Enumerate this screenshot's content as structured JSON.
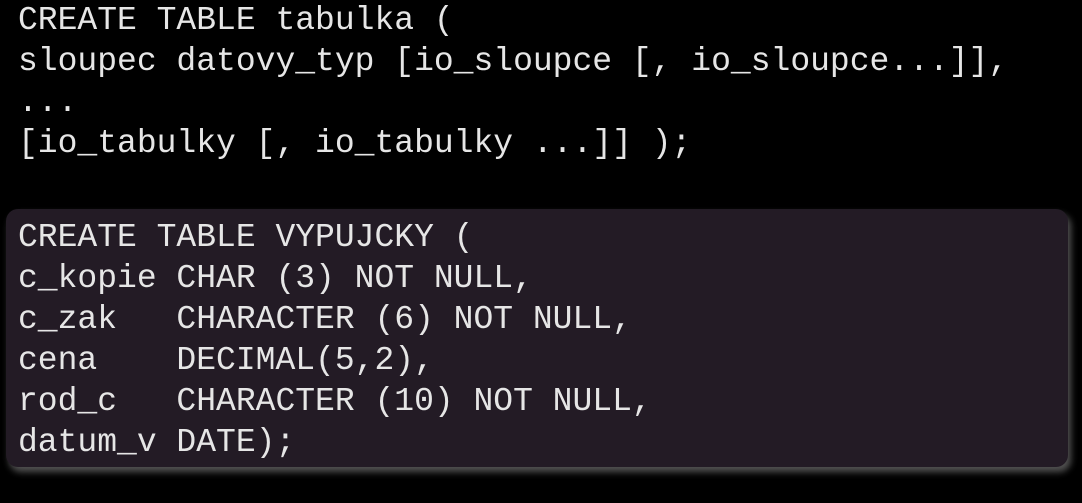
{
  "syntax": {
    "lines": [
      "CREATE TABLE tabulka (",
      "sloupec datovy_typ [io_sloupce [, io_sloupce...]],",
      "...",
      "[io_tabulky [, io_tabulky ...]] );"
    ]
  },
  "example": {
    "lines": [
      "CREATE TABLE VYPUJCKY (",
      "c_kopie CHAR (3) NOT NULL,",
      "c_zak   CHARACTER (6) NOT NULL,",
      "cena    DECIMAL(5,2),",
      "rod_c   CHARACTER (10) NOT NULL,",
      "datum_v DATE);"
    ]
  },
  "colors": {
    "background": "#000000",
    "example_background": "#231b25",
    "text": "#e6e6e6"
  }
}
